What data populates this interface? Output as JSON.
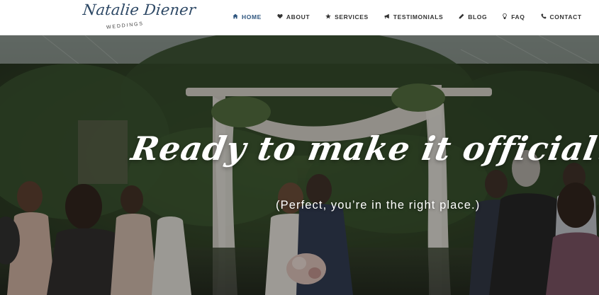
{
  "brand": {
    "name": "Natalie Diener",
    "tagline": "WEDDINGS"
  },
  "nav": {
    "items": [
      {
        "label": "HOME",
        "icon": "home-icon",
        "active": true
      },
      {
        "label": "ABOUT",
        "icon": "heart-icon",
        "active": false
      },
      {
        "label": "SERVICES",
        "icon": "star-icon",
        "active": false
      },
      {
        "label": "TESTIMONIALS",
        "icon": "megaphone-icon",
        "active": false
      },
      {
        "label": "BLOG",
        "icon": "pencil-icon",
        "active": false
      },
      {
        "label": "FAQ",
        "icon": "lightbulb-icon",
        "active": false
      },
      {
        "label": "CONTACT",
        "icon": "phone-icon",
        "active": false
      }
    ]
  },
  "hero": {
    "headline": "Ready to make it official?",
    "subheadline": "(Perfect, you’re in the right place.)"
  },
  "colors": {
    "brand_navy": "#2d4865",
    "nav_active": "#2e557e",
    "nav_text": "#333333",
    "hero_text": "#ffffff"
  }
}
